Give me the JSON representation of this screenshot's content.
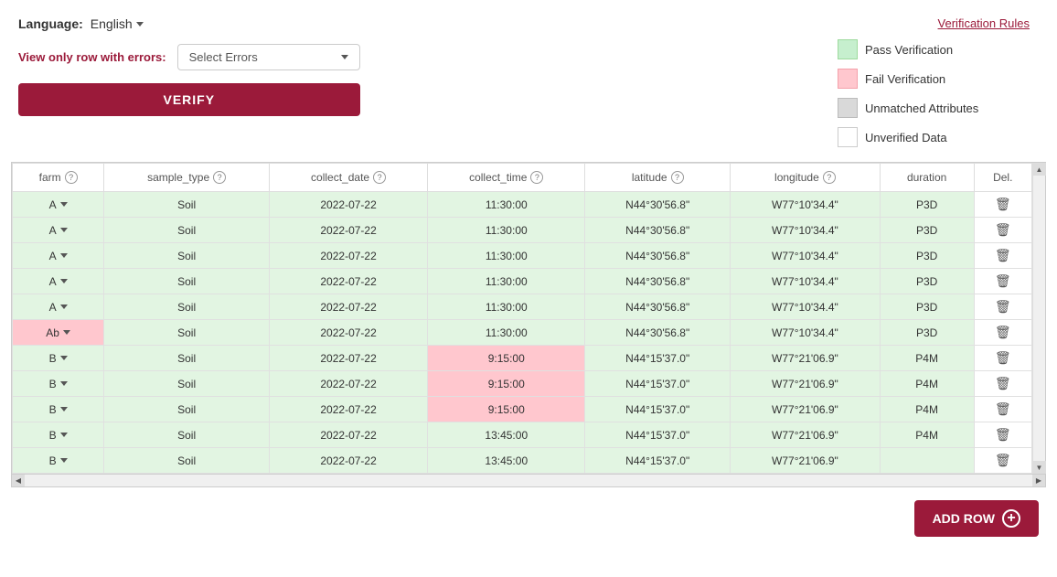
{
  "language": {
    "label": "Language:",
    "value": "English"
  },
  "errors": {
    "label": "View only row with errors:",
    "placeholder": "Select Errors"
  },
  "verify_button": "VERIFY",
  "legend": {
    "rules_link": "Verification Rules",
    "items": [
      {
        "id": "pass",
        "label": "Pass Verification",
        "swatch": "pass"
      },
      {
        "id": "fail",
        "label": "Fail Verification",
        "swatch": "fail"
      },
      {
        "id": "unmatched",
        "label": "Unmatched Attributes",
        "swatch": "unmatched"
      },
      {
        "id": "unverified",
        "label": "Unverified Data",
        "swatch": "unverified"
      }
    ]
  },
  "table": {
    "columns": [
      {
        "id": "farm",
        "label": "farm",
        "has_help": true
      },
      {
        "id": "sample_type",
        "label": "sample_type",
        "has_help": true
      },
      {
        "id": "collect_date",
        "label": "collect_date",
        "has_help": true
      },
      {
        "id": "collect_time",
        "label": "collect_time",
        "has_help": true
      },
      {
        "id": "latitude",
        "label": "latitude",
        "has_help": true
      },
      {
        "id": "longitude",
        "label": "longitude",
        "has_help": true
      },
      {
        "id": "duration",
        "label": "duration",
        "has_help": false
      },
      {
        "id": "del",
        "label": "Del.",
        "has_help": false
      }
    ],
    "rows": [
      {
        "farm": "A",
        "sample_type": "Soil",
        "collect_date": "2022-07-22",
        "collect_time": "11:30:00",
        "latitude": "N44°30'56.8\"",
        "longitude": "W77°10'34.4\"",
        "duration": "P3D",
        "row_class": "pass",
        "time_fail": false
      },
      {
        "farm": "A",
        "sample_type": "Soil",
        "collect_date": "2022-07-22",
        "collect_time": "11:30:00",
        "latitude": "N44°30'56.8\"",
        "longitude": "W77°10'34.4\"",
        "duration": "P3D",
        "row_class": "pass",
        "time_fail": false
      },
      {
        "farm": "A",
        "sample_type": "Soil",
        "collect_date": "2022-07-22",
        "collect_time": "11:30:00",
        "latitude": "N44°30'56.8\"",
        "longitude": "W77°10'34.4\"",
        "duration": "P3D",
        "row_class": "pass",
        "time_fail": false
      },
      {
        "farm": "A",
        "sample_type": "Soil",
        "collect_date": "2022-07-22",
        "collect_time": "11:30:00",
        "latitude": "N44°30'56.8\"",
        "longitude": "W77°10'34.4\"",
        "duration": "P3D",
        "row_class": "pass",
        "time_fail": false
      },
      {
        "farm": "A",
        "sample_type": "Soil",
        "collect_date": "2022-07-22",
        "collect_time": "11:30:00",
        "latitude": "N44°30'56.8\"",
        "longitude": "W77°10'34.4\"",
        "duration": "P3D",
        "row_class": "pass",
        "time_fail": false
      },
      {
        "farm": "Ab",
        "sample_type": "Soil",
        "collect_date": "2022-07-22",
        "collect_time": "11:30:00",
        "latitude": "N44°30'56.8\"",
        "longitude": "W77°10'34.4\"",
        "duration": "P3D",
        "row_class": "fail-farm",
        "time_fail": false
      },
      {
        "farm": "B",
        "sample_type": "Soil",
        "collect_date": "2022-07-22",
        "collect_time": "9:15:00",
        "latitude": "N44°15'37.0\"",
        "longitude": "W77°21'06.9\"",
        "duration": "P4M",
        "row_class": "pass",
        "time_fail": true
      },
      {
        "farm": "B",
        "sample_type": "Soil",
        "collect_date": "2022-07-22",
        "collect_time": "9:15:00",
        "latitude": "N44°15'37.0\"",
        "longitude": "W77°21'06.9\"",
        "duration": "P4M",
        "row_class": "pass",
        "time_fail": true
      },
      {
        "farm": "B",
        "sample_type": "Soil",
        "collect_date": "2022-07-22",
        "collect_time": "9:15:00",
        "latitude": "N44°15'37.0\"",
        "longitude": "W77°21'06.9\"",
        "duration": "P4M",
        "row_class": "pass",
        "time_fail": true
      },
      {
        "farm": "B",
        "sample_type": "Soil",
        "collect_date": "2022-07-22",
        "collect_time": "13:45:00",
        "latitude": "N44°15'37.0\"",
        "longitude": "W77°21'06.9\"",
        "duration": "P4M",
        "row_class": "pass",
        "time_fail": false
      },
      {
        "farm": "B",
        "sample_type": "Soil",
        "collect_date": "2022-07-22",
        "collect_time": "13:45:00",
        "latitude": "N44°15'37.0\"",
        "longitude": "W77°21'06.9\"",
        "duration": "",
        "row_class": "pass",
        "time_fail": false,
        "partial": true
      }
    ]
  },
  "add_row_button": "ADD ROW"
}
